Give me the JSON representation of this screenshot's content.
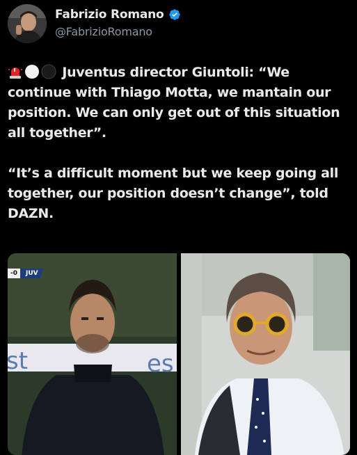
{
  "author": {
    "display_name": "Fabrizio Romano",
    "handle": "@FabrizioRomano",
    "verified": true
  },
  "tweet": {
    "emojis": [
      "red-siren-emoji",
      "white-circle-emoji",
      "black-circle-emoji"
    ],
    "paragraph_1": "Juventus director Giuntoli: “We continue with Thiago Motta, we mantain our position. We can only get out of this situation all together”.",
    "paragraph_2": "“It’s a difficult moment but we keep going all together, our position doesn’t change”, told DAZN."
  },
  "media": {
    "left_photo": {
      "scorebug_score": "-0",
      "scorebug_team": "JUV",
      "banner_text_left": "st",
      "banner_text_right": "es"
    }
  },
  "colors": {
    "background": "#000000",
    "text": "#e7e9ea",
    "handle": "#8b98a5",
    "verified": "#1d9bf0",
    "scorebug_team_bg": "#1d3e7a"
  }
}
